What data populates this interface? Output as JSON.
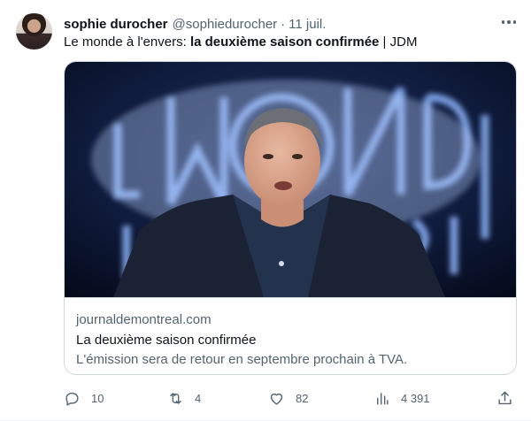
{
  "tweet": {
    "author_name": "sophie durocher",
    "author_handle": "@sophiedurocher",
    "separator": "·",
    "date": "11 juil.",
    "text_prefix": "Le monde à l'envers: ",
    "text_bold": "la deuxième saison confirmée",
    "text_suffix": " | JDM"
  },
  "card": {
    "domain": "journaldemontreal.com",
    "title": "La deuxième saison confirmée",
    "description": "L'émission sera de retour en septembre prochain à TVA.",
    "image_sign_text": "le MONDE à l'envers"
  },
  "actions": {
    "replies": "10",
    "retweets": "4",
    "likes": "82",
    "views": "4 391"
  },
  "icons": {
    "more": "more-horizontal-icon",
    "reply": "reply-icon",
    "retweet": "retweet-icon",
    "like": "heart-icon",
    "views": "views-chart-icon",
    "share": "share-icon"
  },
  "colors": {
    "text": "#0f1419",
    "muted": "#536471",
    "border": "#cfd9de",
    "image_bg": "#0d1a40",
    "sign_glow": "#8fb7ff"
  }
}
